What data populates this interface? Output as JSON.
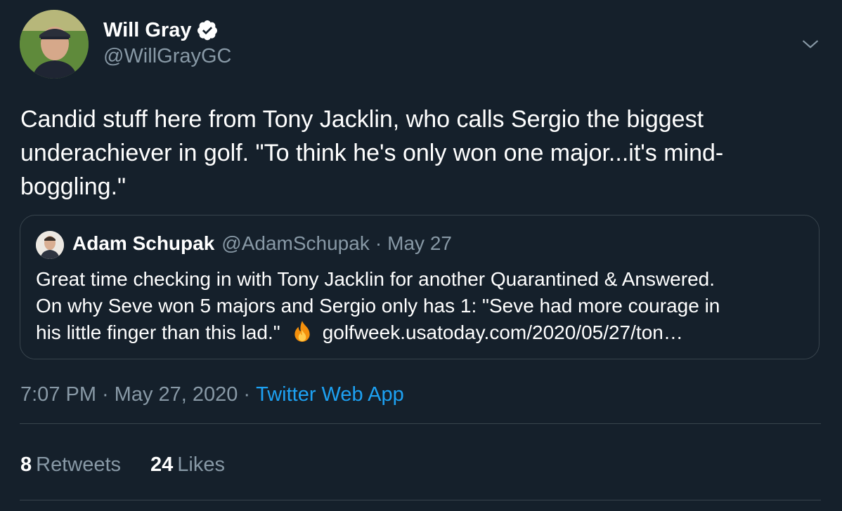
{
  "author": {
    "display_name": "Will Gray",
    "handle": "@WillGrayGC",
    "verified": true,
    "avatar_icon": "profile-photo"
  },
  "tweet": {
    "text": "Candid stuff here from Tony Jacklin, who calls Sergio the biggest underachiever in golf. \"To think he's only won one major...it's mind-boggling.\""
  },
  "quoted_tweet": {
    "display_name": "Adam Schupak",
    "handle": "@AdamSchupak",
    "separator": "·",
    "date": "May 27",
    "lines": [
      "Great time checking in with Tony Jacklin for another Quarantined & Answered.",
      "On why Seve won 5 majors and Sergio only has 1: \"Seve had more courage in"
    ],
    "line3_text": "his little finger than this lad.\"",
    "emoji_icon": "fire-icon",
    "link": "golfweek.usatoday.com/2020/05/27/ton…"
  },
  "meta": {
    "time": "7:07 PM",
    "separator": "·",
    "date": "May 27, 2020",
    "source": "Twitter Web App"
  },
  "stats": {
    "retweets_count": "8",
    "retweets_label": "Retweets",
    "likes_count": "24",
    "likes_label": "Likes"
  },
  "colors": {
    "background": "#15202b",
    "primary_text": "#ffffff",
    "secondary_text": "#8899a6",
    "accent": "#1da1f2",
    "border": "#38444d"
  }
}
